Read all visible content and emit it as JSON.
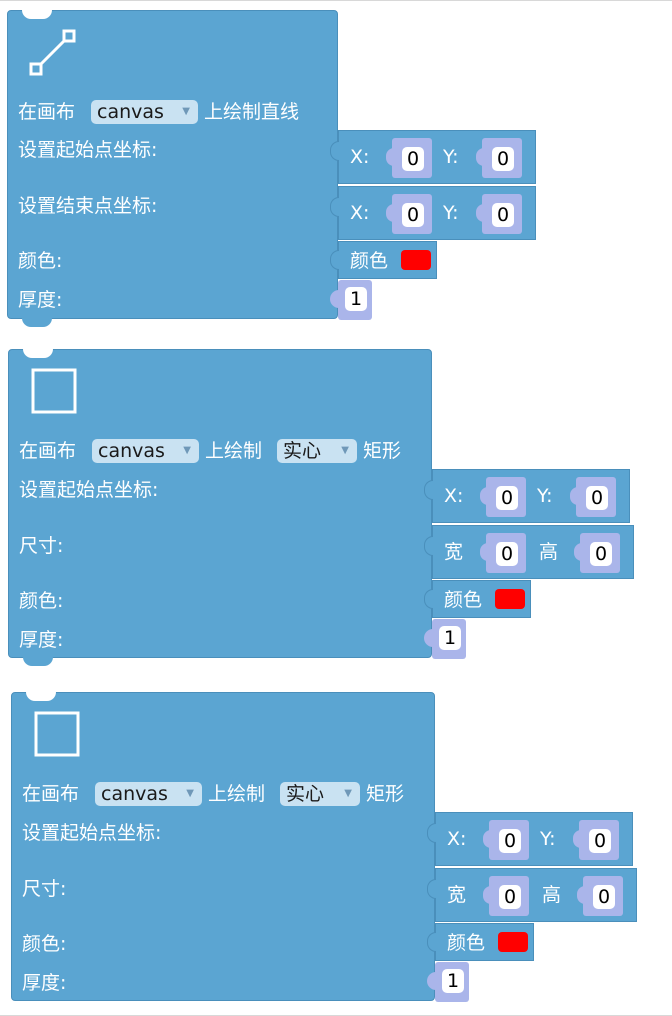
{
  "blocks": [
    {
      "prefix": "在画布",
      "canvas": "canvas",
      "suffix": "上绘制直线",
      "start_label": "设置起始点坐标:",
      "end_label": "设置结束点坐标:",
      "color_label": "颜色:",
      "thickness_label": "厚度:",
      "x_label": "X:",
      "y_label": "Y:",
      "start_x": "0",
      "start_y": "0",
      "end_x": "0",
      "end_y": "0",
      "color_word": "颜色",
      "color": "#ff0000",
      "thickness": "1"
    },
    {
      "prefix": "在画布",
      "canvas": "canvas",
      "mid": "上绘制",
      "fill": "实心",
      "suffix": "矩形",
      "start_label": "设置起始点坐标:",
      "size_label": "尺寸:",
      "color_label": "颜色:",
      "thickness_label": "厚度:",
      "x_label": "X:",
      "y_label": "Y:",
      "w_label": "宽",
      "h_label": "高",
      "x": "0",
      "y": "0",
      "w": "0",
      "h": "0",
      "color_word": "颜色",
      "color": "#ff0000",
      "thickness": "1"
    },
    {
      "prefix": "在画布",
      "canvas": "canvas",
      "mid": "上绘制",
      "fill": "实心",
      "suffix": "矩形",
      "start_label": "设置起始点坐标:",
      "size_label": "尺寸:",
      "color_label": "颜色:",
      "thickness_label": "厚度:",
      "x_label": "X:",
      "y_label": "Y:",
      "w_label": "宽",
      "h_label": "高",
      "x": "0",
      "y": "0",
      "w": "0",
      "h": "0",
      "color_word": "颜色",
      "color": "#ff0000",
      "thickness": "1"
    }
  ]
}
